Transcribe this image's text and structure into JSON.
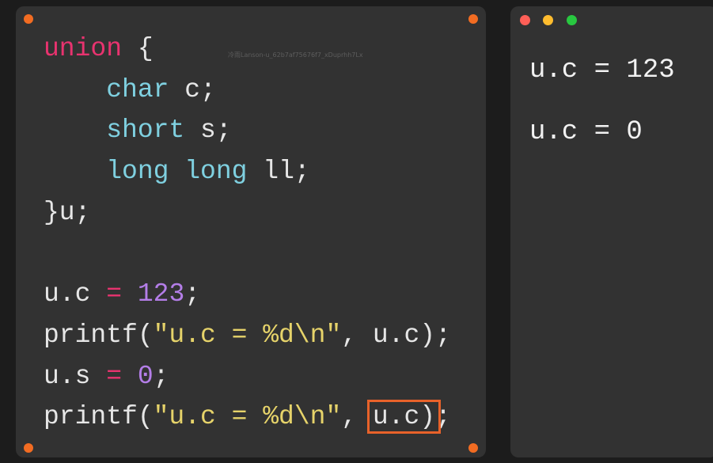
{
  "code_panel": {
    "accent_dot_color": "#f26c22",
    "lines": [
      {
        "kw": "union",
        "rest": " {"
      },
      {
        "indent": "    ",
        "ty": "char",
        "rest": " c;"
      },
      {
        "indent": "    ",
        "ty": "short",
        "rest": " s;"
      },
      {
        "indent": "    ",
        "ty1": "long",
        "sp": " ",
        "ty2": "long",
        "rest": " ll;"
      },
      {
        "text": "}u;"
      },
      {
        "text": ""
      },
      {
        "a": "u.c ",
        "op": "=",
        "b": " ",
        "num": "123",
        "c": ";"
      },
      {
        "a": "printf(",
        "str": "\"u.c = %d\\n\"",
        "b": ", u.c);"
      },
      {
        "a": "u.s ",
        "op": "=",
        "b": " ",
        "num": "0",
        "c": ";"
      },
      {
        "a": "printf(",
        "str": "\"u.c = %d\\n\"",
        "b": ", ",
        "hl": "u.c)",
        "c": ";"
      }
    ],
    "watermark": "冷雨Lanson-u_62b7af75676f7_xDuprhh7Lx"
  },
  "output_panel": {
    "window_dots": [
      {
        "name": "close",
        "color": "#ff5f57"
      },
      {
        "name": "minimize",
        "color": "#febc2e"
      },
      {
        "name": "maximize",
        "color": "#28c840"
      }
    ],
    "lines": [
      "u.c = 123",
      "u.c = 0"
    ]
  },
  "colors": {
    "keyword": "#e8336f",
    "type": "#7fd0e0",
    "number": "#b47ee8",
    "string": "#e6d36a",
    "highlight_box": "#e8622a"
  }
}
